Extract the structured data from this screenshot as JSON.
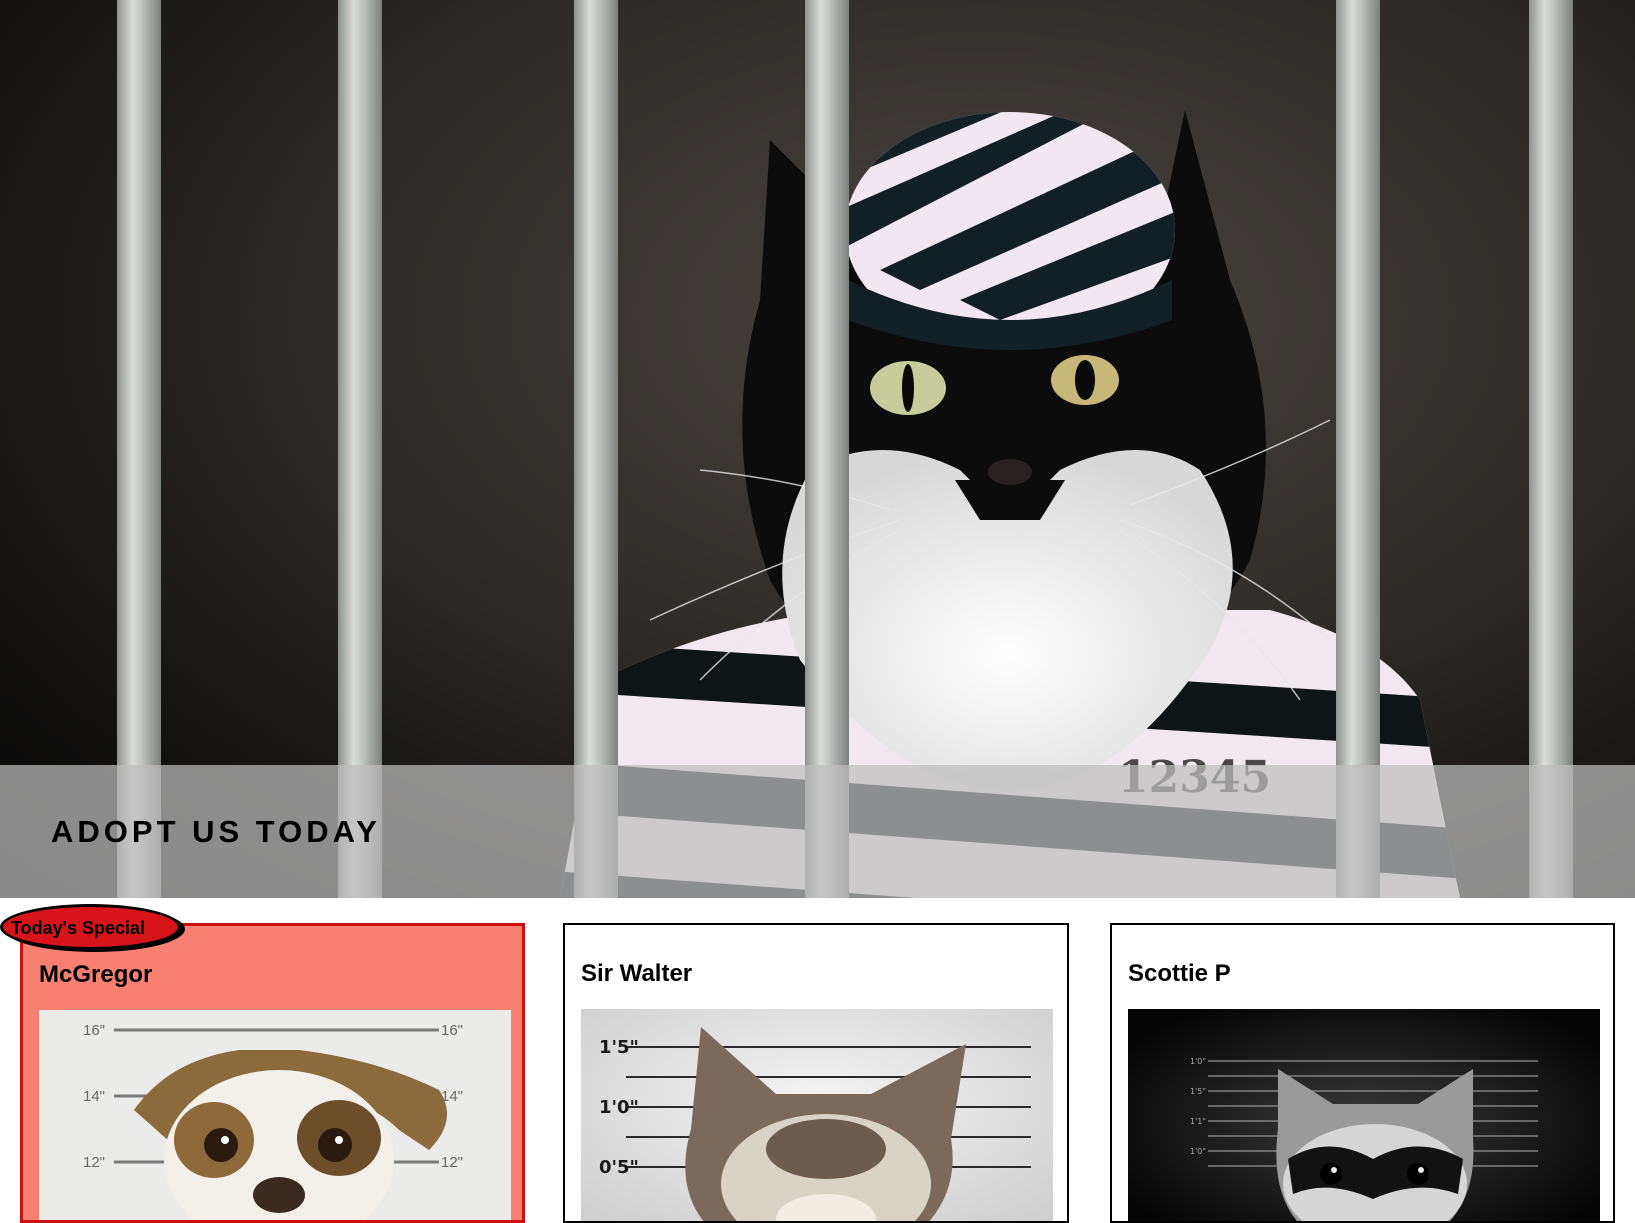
{
  "hero": {
    "title": "ADOPT US TODAY",
    "image_subject": "tuxedo cat in striped prisoner cap and uniform behind jail bars",
    "prisoner_number": "12345"
  },
  "badge": {
    "label": "Today's Special",
    "color": "#d7141a"
  },
  "pets": [
    {
      "name": "McGregor",
      "special": true,
      "image_subject": "pug-mix dog mugshot",
      "height_marks": [
        "16\"",
        "16\"",
        "14\"",
        "14\"",
        "12\"",
        "12\""
      ]
    },
    {
      "name": "Sir Walter",
      "special": false,
      "image_subject": "grumpy cat mugshot",
      "height_marks": [
        "1'5\"",
        "1'0\"",
        "0'5\""
      ]
    },
    {
      "name": "Scottie P",
      "special": false,
      "image_subject": "raccoon mugshot",
      "height_marks": [
        "1'0\"",
        "1'5\"",
        "1'1\"",
        "1'0\""
      ]
    }
  ],
  "colors": {
    "special_card_bg": "#f78073",
    "special_card_border": "#cc1010",
    "card_border": "#000000"
  }
}
